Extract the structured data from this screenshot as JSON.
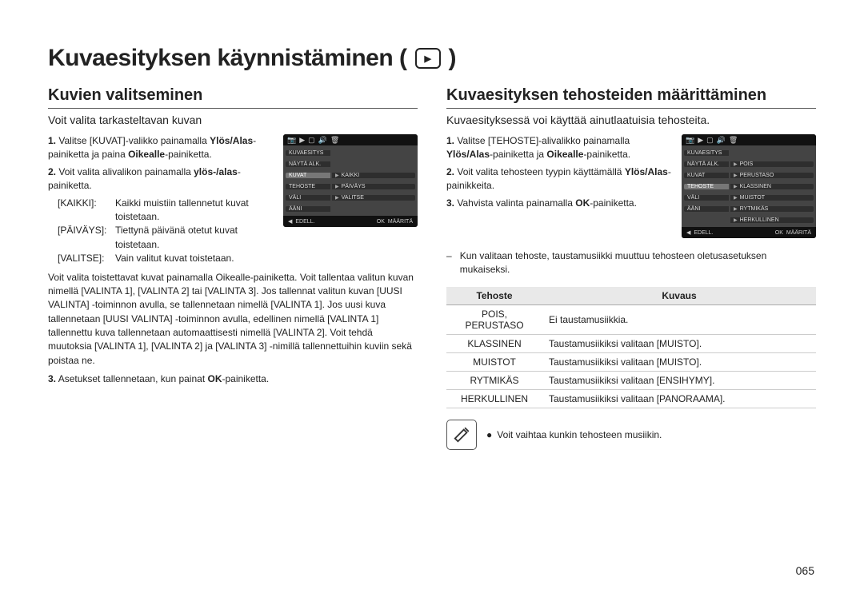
{
  "title": "Kuvaesityksen käynnistäminen (",
  "title_close": ")",
  "page_number": "065",
  "left": {
    "heading": "Kuvien valitseminen",
    "lead": "Voit valita tarkasteltavan kuvan",
    "steps": {
      "s1a": "Valitse [KUVAT]-valikko painamalla ",
      "s1b": "Ylös/Alas",
      "s1c": "-painiketta ja paina ",
      "s1d": "Oikealle",
      "s1e": "-painiketta.",
      "s2a": "Voit valita alivalikon painamalla ",
      "s2b": "ylös-/alas",
      "s2c": "-painiketta."
    },
    "defs": {
      "t1": "[KAIKKI]:",
      "d1": "Kaikki muistiin tallennetut kuvat toistetaan.",
      "t2": "[PÄIVÄYS]:",
      "d2": "Tiettynä päivänä otetut kuvat toistetaan.",
      "t3": "[VALITSE]:",
      "d3": "Vain valitut kuvat toistetaan."
    },
    "long": "Voit valita toistettavat kuvat painamalla Oikealle-painiketta. Voit tallentaa valitun kuvan nimellä [VALINTA 1], [VALINTA 2] tai [VALINTA 3]. Jos tallennat valitun kuvan [UUSI VALINTA] -toiminnon avulla, se tallennetaan nimellä [VALINTA 1]. Jos uusi kuva tallennetaan [UUSI VALINTA] -toiminnon avulla, edellinen nimellä [VALINTA 1] tallennettu kuva tallennetaan automaattisesti nimellä [VALINTA 2]. Voit tehdä muutoksia [VALINTA 1], [VALINTA 2] ja [VALINTA 3] -nimillä tallennettuihin kuviin sekä poistaa ne.",
    "s3a": "Asetukset tallennetaan, kun painat ",
    "s3b": "OK",
    "s3c": "-painiketta.",
    "osd": {
      "rows": [
        {
          "l": "KUVAESITYS",
          "r": ""
        },
        {
          "l": "NÄYTÄ ALK.",
          "r": ""
        },
        {
          "l": "KUVAT",
          "r": "KAIKKI",
          "sel": true
        },
        {
          "l": "TEHOSTE",
          "r": "PÄIVÄYS"
        },
        {
          "l": "VÄLI",
          "r": "VALITSE"
        },
        {
          "l": "ÄÄNI",
          "r": ""
        }
      ],
      "footer_l": "EDELL.",
      "footer_r": "MÄÄRITÄ",
      "footer_ok": "OK"
    }
  },
  "right": {
    "heading": "Kuvaesityksen tehosteiden määrittäminen",
    "lead": "Kuvaesityksessä voi käyttää ainutlaatuisia tehosteita.",
    "steps": {
      "s1a": "Valitse [TEHOSTE]-alivalikko painamalla ",
      "s1b": "Ylös/Alas",
      "s1c": "-painiketta ja ",
      "s1d": "Oikealle",
      "s1e": "-painiketta.",
      "s2a": "Voit valita tehosteen tyypin käyttämällä ",
      "s2b": "Ylös/Alas",
      "s2c": "-painikkeita.",
      "s3a": "Vahvista valinta painamalla ",
      "s3b": "OK",
      "s3c": "-painiketta."
    },
    "osd": {
      "rows": [
        {
          "l": "KUVAESITYS",
          "r": ""
        },
        {
          "l": "NÄYTÄ ALK.",
          "r": "POIS"
        },
        {
          "l": "KUVAT",
          "r": "PERUSTASO"
        },
        {
          "l": "TEHOSTE",
          "r": "KLASSINEN",
          "sel": true
        },
        {
          "l": "VÄLI",
          "r": "MUISTOT"
        },
        {
          "l": "ÄÄNI",
          "r": "RYTMIKÄS"
        },
        {
          "l": "",
          "r": "HERKULLINEN"
        }
      ],
      "footer_l": "EDELL.",
      "footer_r": "MÄÄRITÄ",
      "footer_ok": "OK"
    },
    "note": "Kun valitaan tehoste, taustamusiikki muuttuu tehosteen oletusasetuksen mukaiseksi.",
    "table": {
      "h1": "Tehoste",
      "h2": "Kuvaus",
      "rows": [
        {
          "t": "POIS, PERUSTASO",
          "d": "Ei taustamusiikkia."
        },
        {
          "t": "KLASSINEN",
          "d": "Taustamusiikiksi valitaan [MUISTO]."
        },
        {
          "t": "MUISTOT",
          "d": "Taustamusiikiksi valitaan [MUISTO]."
        },
        {
          "t": "RYTMIKÄS",
          "d": "Taustamusiikiksi valitaan [ENSIHYMY]."
        },
        {
          "t": "HERKULLINEN",
          "d": "Taustamusiikiksi valitaan [PANORAAMA]."
        }
      ]
    },
    "tip": "Voit vaihtaa kunkin tehosteen musiikin."
  }
}
